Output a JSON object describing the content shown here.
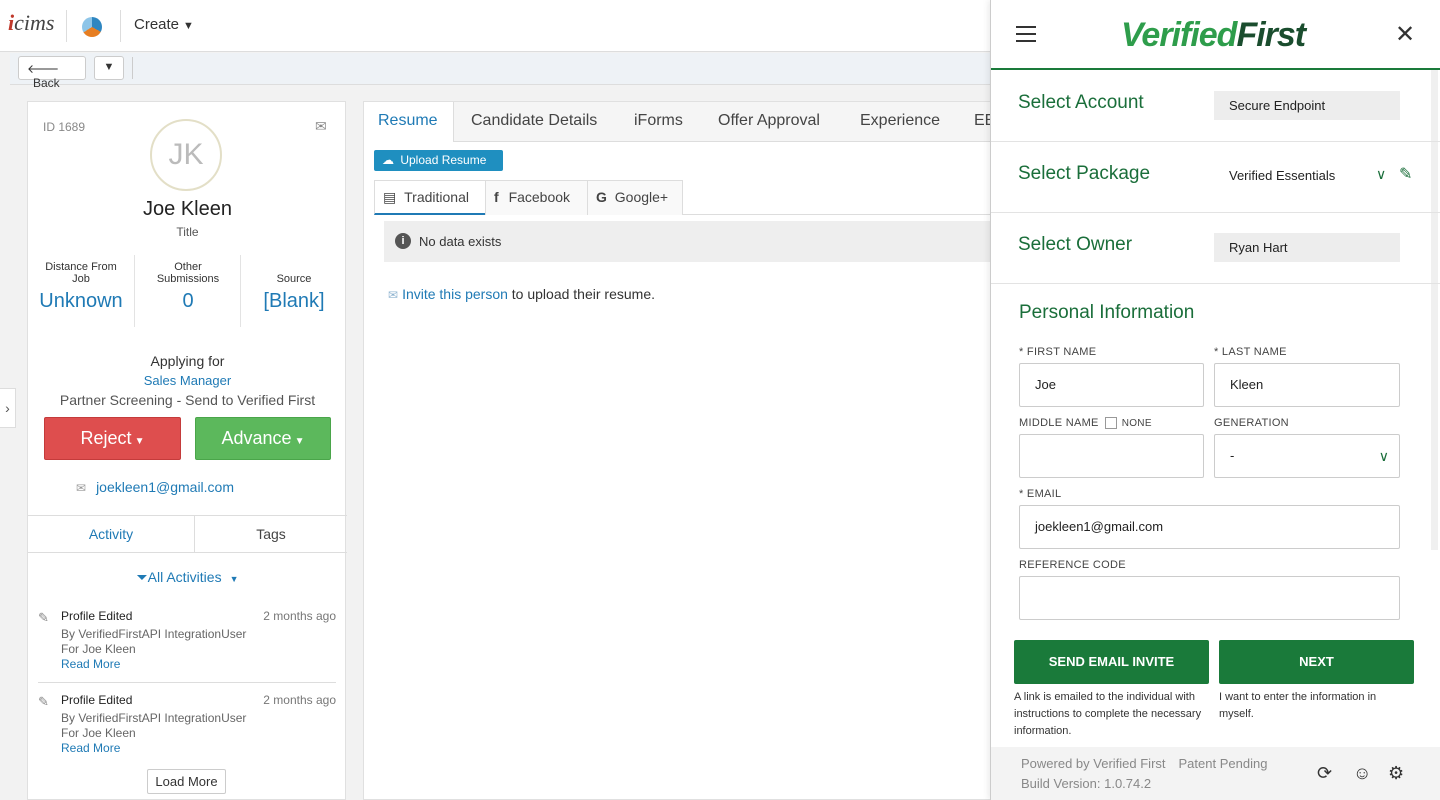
{
  "topbar": {
    "logo_text": "icims",
    "create_label": "Create",
    "create_chevron": "⌄"
  },
  "subbar": {
    "back_label": "Back",
    "dropdown_icon": "chevron-down-icon"
  },
  "candidate": {
    "id_label": "ID 1689",
    "initials": "JK",
    "name": "Joe Kleen",
    "title": "Title",
    "stats": [
      {
        "label": "Distance From Job",
        "value": "Unknown"
      },
      {
        "label": "Other Submissions",
        "value": "0"
      },
      {
        "label": "Source",
        "value": "[Blank]"
      }
    ],
    "applying_for_label": "Applying for",
    "job_title": "Sales Manager",
    "workflow_status": "Partner Screening - Send to Verified First",
    "reject_label": "Reject",
    "advance_label": "Advance",
    "email": "joekleen1@gmail.com"
  },
  "activity": {
    "tabs": [
      "Activity",
      "Tags"
    ],
    "filter_label": "All Activities",
    "items": [
      {
        "title": "Profile Edited",
        "when": "2 months ago",
        "by": "By VerifiedFirstAPI IntegrationUser",
        "for": "For Joe Kleen",
        "read_more": "Read More"
      },
      {
        "title": "Profile Edited",
        "when": "2 months ago",
        "by": "By VerifiedFirstAPI IntegrationUser",
        "for": "For Joe Kleen",
        "read_more": "Read More"
      }
    ],
    "load_more_label": "Load More"
  },
  "main": {
    "tabs": [
      "Resume",
      "Candidate Details",
      "iForms",
      "Offer Approval",
      "Experience",
      "EE"
    ],
    "upload_label": "Upload Resume",
    "resume_tabs": [
      "Traditional",
      "Facebook",
      "Google+"
    ],
    "no_data_text": "No data exists",
    "invite_link": "Invite this person",
    "invite_rest": " to upload their resume."
  },
  "verified_first": {
    "logo_part1": "Verified",
    "logo_part2": "First",
    "select_account_label": "Select Account",
    "select_account_value": "Secure Endpoint",
    "select_package_label": "Select Package",
    "select_package_value": "Verified Essentials",
    "select_owner_label": "Select Owner",
    "select_owner_value": "Ryan Hart",
    "personal_info_title": "Personal Information",
    "first_name_label": "* FIRST NAME",
    "first_name_value": "Joe",
    "last_name_label": "* LAST NAME",
    "last_name_value": "Kleen",
    "middle_name_label": "MIDDLE NAME",
    "none_label": "NONE",
    "middle_name_value": "",
    "generation_label": "GENERATION",
    "generation_value": "-",
    "email_label": "* EMAIL",
    "email_value": "joekleen1@gmail.com",
    "reference_code_label": "REFERENCE CODE",
    "reference_code_value": "",
    "send_invite_label": "SEND EMAIL INVITE",
    "send_invite_help": "A link is emailed to the individual with instructions to complete the necessary information.",
    "next_label": "NEXT",
    "next_help": "I want to enter the information in myself.",
    "footer_powered": "Powered by Verified First",
    "footer_patent": "Patent Pending",
    "footer_build": "Build Version: 1.0.74.2"
  },
  "colors": {
    "accent_blue": "#1f7ab5",
    "reject_red": "#de4e4e",
    "advance_green": "#5cb85c",
    "vf_green": "#1a7a3a"
  }
}
